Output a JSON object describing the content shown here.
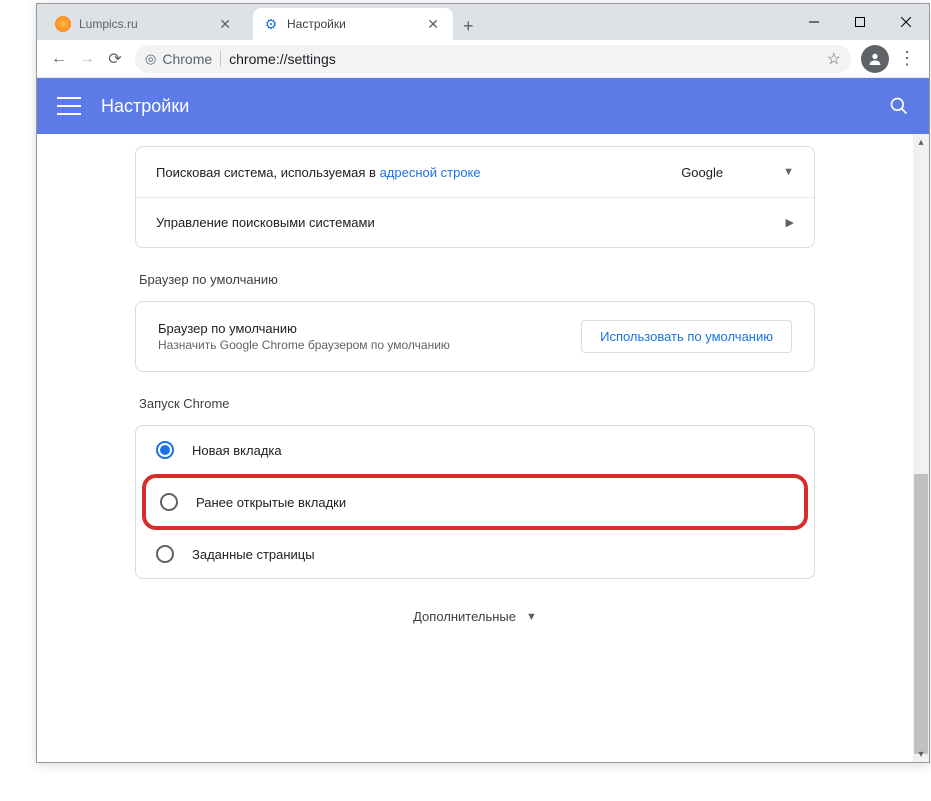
{
  "tabs": [
    {
      "title": "Lumpics.ru",
      "icon": "orange"
    },
    {
      "title": "Настройки",
      "icon": "gear",
      "active": true
    }
  ],
  "address": {
    "host": "Chrome",
    "path": "chrome://settings"
  },
  "header": {
    "title": "Настройки"
  },
  "search_engine": {
    "row1_prefix": "Поисковая система, используемая в ",
    "row1_link": "адресной строке",
    "row1_value": "Google",
    "row2": "Управление поисковыми системами"
  },
  "default_browser": {
    "section": "Браузер по умолчанию",
    "title": "Браузер по умолчанию",
    "subtitle": "Назначить Google Chrome браузером по умолчанию",
    "button": "Использовать по умолчанию"
  },
  "startup": {
    "section": "Запуск Chrome",
    "options": [
      "Новая вкладка",
      "Ранее открытые вкладки",
      "Заданные страницы"
    ]
  },
  "more": "Дополнительные"
}
